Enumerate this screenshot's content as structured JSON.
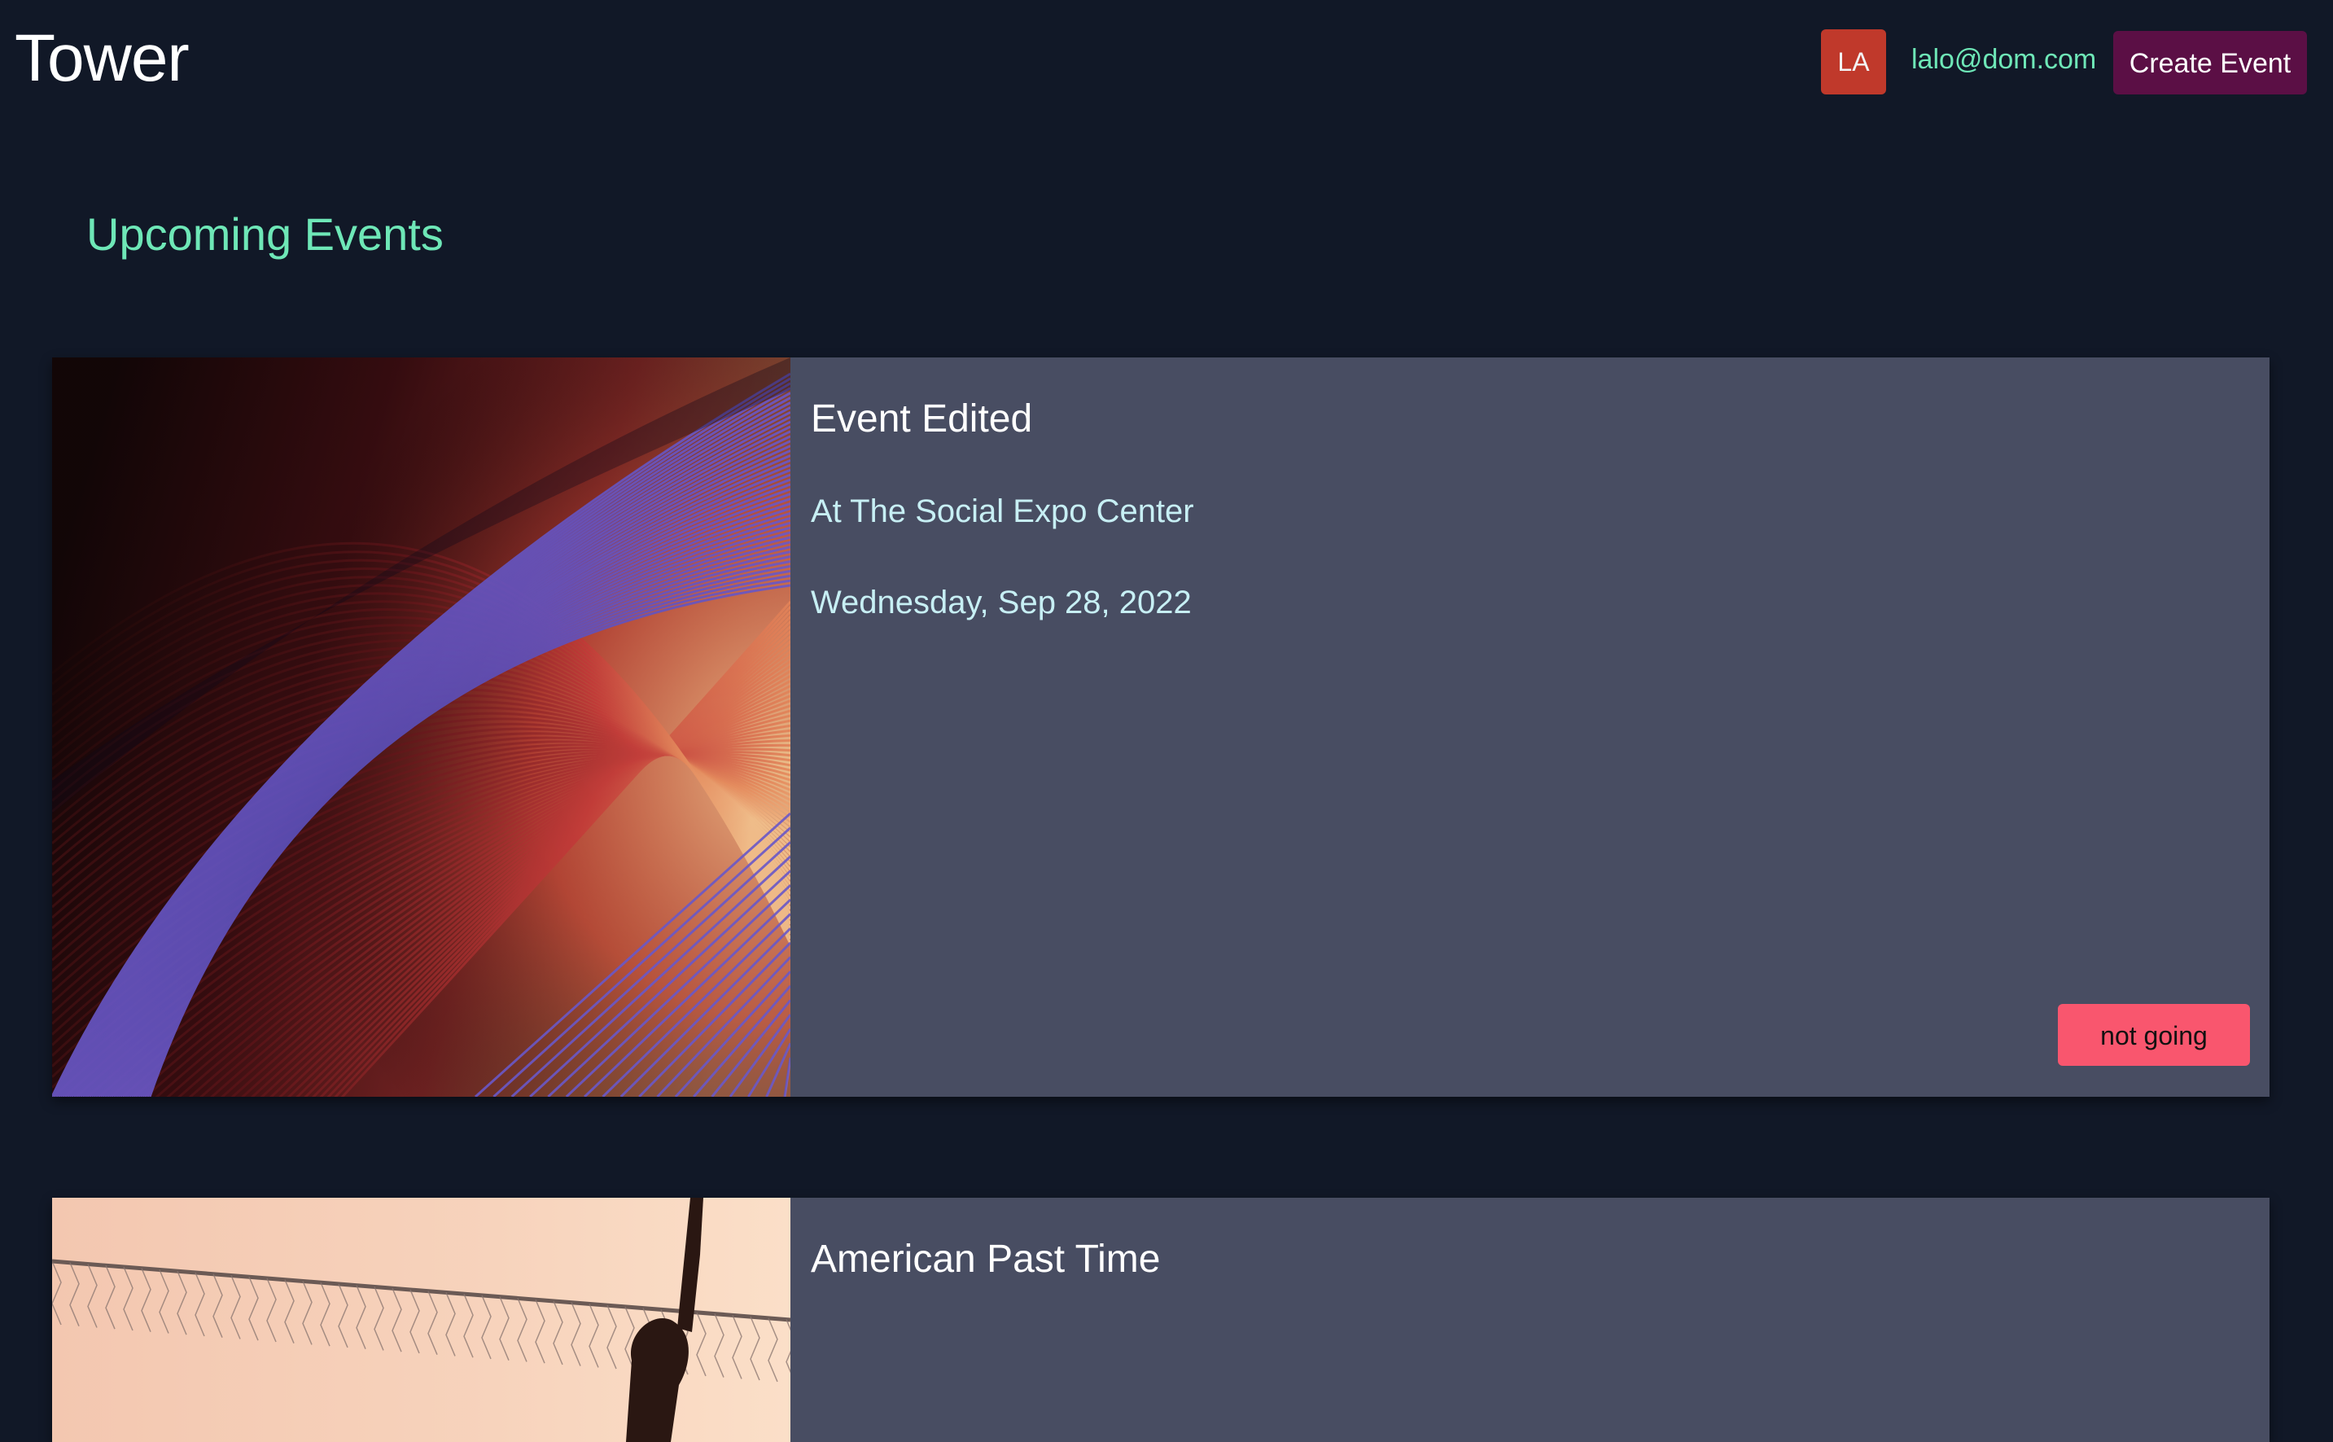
{
  "navbar": {
    "brand": "Tower",
    "avatar_initials": "LA",
    "user_email": "lalo@dom.com",
    "create_event_label": "Create Event"
  },
  "main": {
    "section_title": "Upcoming Events",
    "events": [
      {
        "name": "Event Edited",
        "location": "At The Social Expo Center",
        "date": "Wednesday, Sep 28, 2022",
        "rsvp_label": "not going"
      },
      {
        "name": "American Past Time"
      }
    ]
  },
  "colors": {
    "background": "#111827",
    "accent_green": "#6ee7b7",
    "card": "#484d62",
    "avatar": "#c0392b",
    "create_button": "#5b0f45",
    "rsvp_button": "#f9566e"
  }
}
